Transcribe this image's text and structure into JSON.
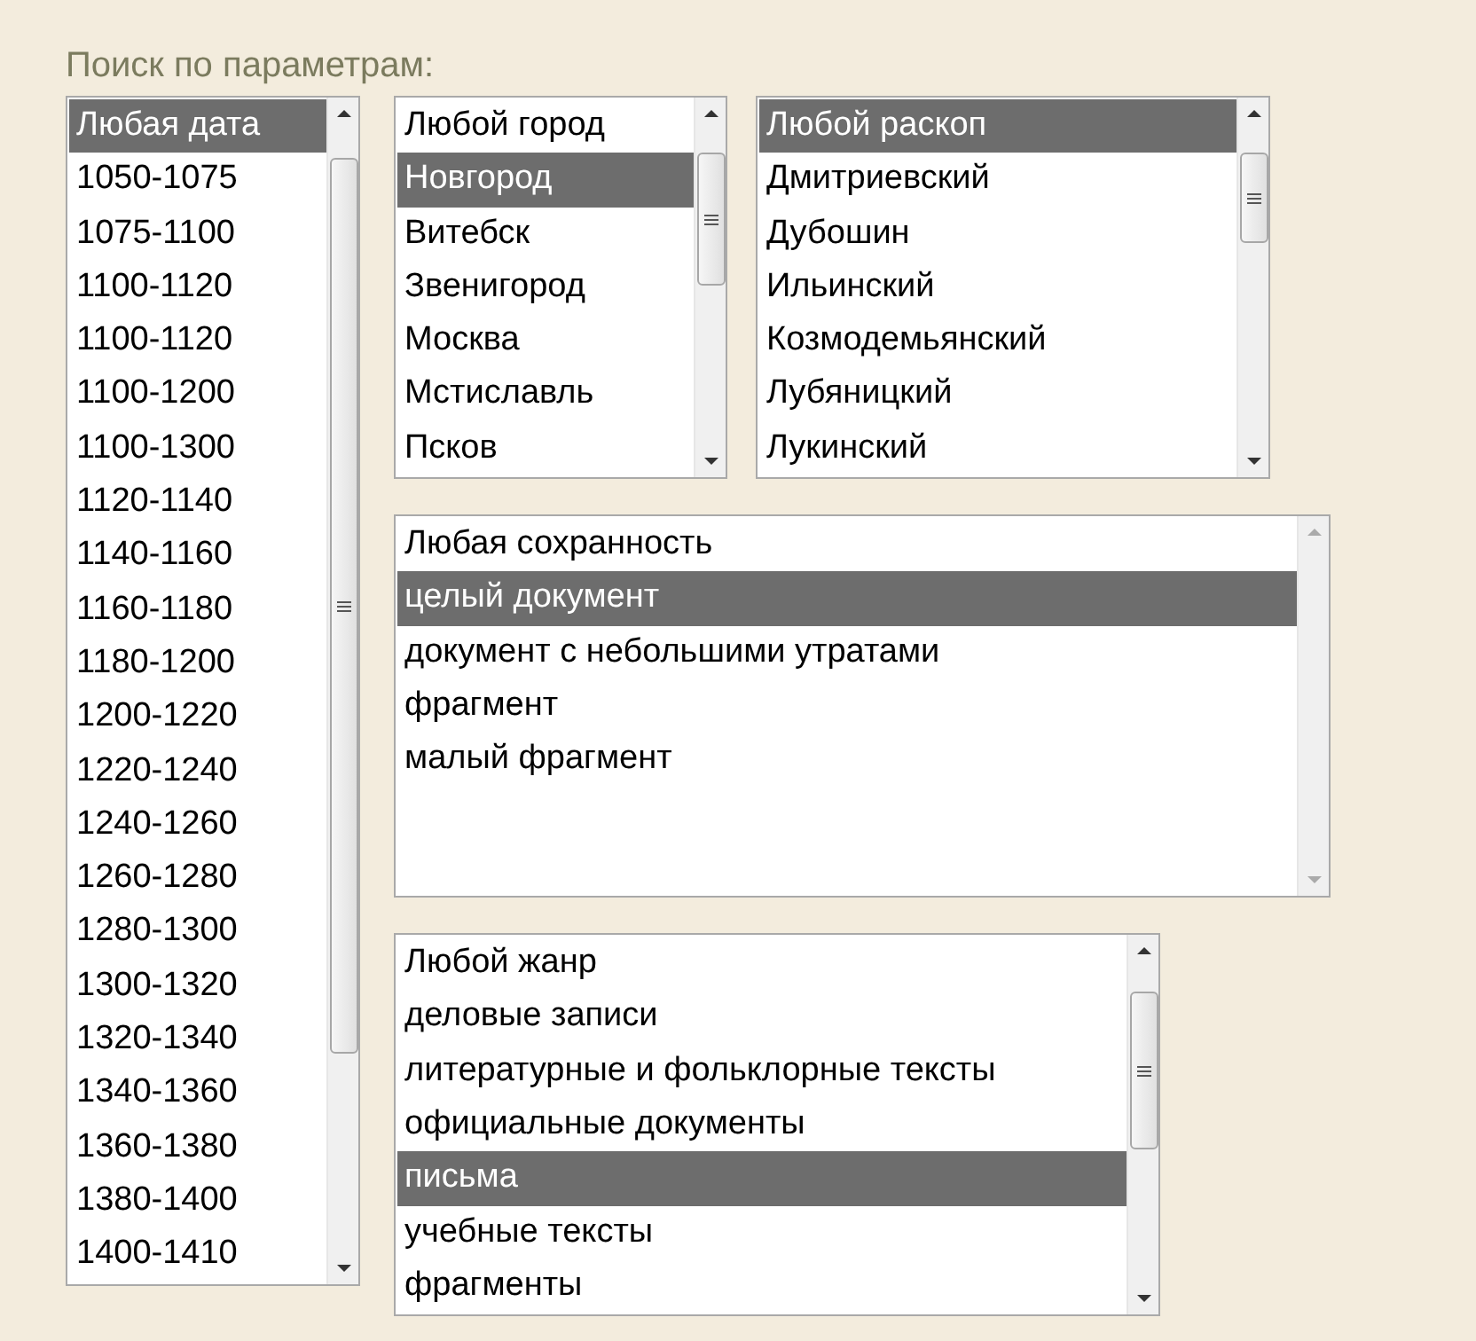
{
  "title": "Поиск по параметрам:",
  "listboxes": [
    {
      "scroll_enabled": true,
      "options": [
        {
          "label": "Любая дата",
          "selected": true
        },
        {
          "label": "1050-1075",
          "selected": false
        },
        {
          "label": "1075-1100",
          "selected": false
        },
        {
          "label": "1100-1120",
          "selected": false
        },
        {
          "label": "1100-1120",
          "selected": false
        },
        {
          "label": "1100-1200",
          "selected": false
        },
        {
          "label": "1100-1300",
          "selected": false
        },
        {
          "label": "1120-1140",
          "selected": false
        },
        {
          "label": "1140-1160",
          "selected": false
        },
        {
          "label": "1160-1180",
          "selected": false
        },
        {
          "label": "1180-1200",
          "selected": false
        },
        {
          "label": "1200-1220",
          "selected": false
        },
        {
          "label": "1220-1240",
          "selected": false
        },
        {
          "label": "1240-1260",
          "selected": false
        },
        {
          "label": "1260-1280",
          "selected": false
        },
        {
          "label": "1280-1300",
          "selected": false
        },
        {
          "label": "1300-1320",
          "selected": false
        },
        {
          "label": "1320-1340",
          "selected": false
        },
        {
          "label": "1340-1360",
          "selected": false
        },
        {
          "label": "1360-1380",
          "selected": false
        },
        {
          "label": "1380-1400",
          "selected": false
        },
        {
          "label": "1400-1410",
          "selected": false
        }
      ]
    },
    {
      "scroll_enabled": true,
      "options": [
        {
          "label": "Любой город",
          "selected": false
        },
        {
          "label": "Новгород",
          "selected": true
        },
        {
          "label": "Витебск",
          "selected": false
        },
        {
          "label": "Звенигород",
          "selected": false
        },
        {
          "label": "Москва",
          "selected": false
        },
        {
          "label": "Мстиславль",
          "selected": false
        },
        {
          "label": "Псков",
          "selected": false
        }
      ]
    },
    {
      "scroll_enabled": true,
      "options": [
        {
          "label": "Любой раскоп",
          "selected": true
        },
        {
          "label": "Дмитриевский",
          "selected": false
        },
        {
          "label": "Дубошин",
          "selected": false
        },
        {
          "label": "Ильинский",
          "selected": false
        },
        {
          "label": "Козмодемьянский",
          "selected": false
        },
        {
          "label": "Лубяницкий",
          "selected": false
        },
        {
          "label": "Лукинский",
          "selected": false
        }
      ]
    },
    {
      "scroll_enabled": false,
      "options": [
        {
          "label": "Любая сохранность",
          "selected": false
        },
        {
          "label": "целый документ",
          "selected": true
        },
        {
          "label": "документ с небольшими утратами",
          "selected": false
        },
        {
          "label": "фрагмент",
          "selected": false
        },
        {
          "label": "малый фрагмент",
          "selected": false
        }
      ]
    },
    {
      "scroll_enabled": true,
      "options": [
        {
          "label": "Любой жанр",
          "selected": false
        },
        {
          "label": "деловые записи",
          "selected": false
        },
        {
          "label": "литературные и фольклорные тексты",
          "selected": false
        },
        {
          "label": "официальные документы",
          "selected": false
        },
        {
          "label": "письма",
          "selected": true
        },
        {
          "label": "учебные тексты",
          "selected": false
        },
        {
          "label": "фрагменты",
          "selected": false
        }
      ]
    }
  ]
}
